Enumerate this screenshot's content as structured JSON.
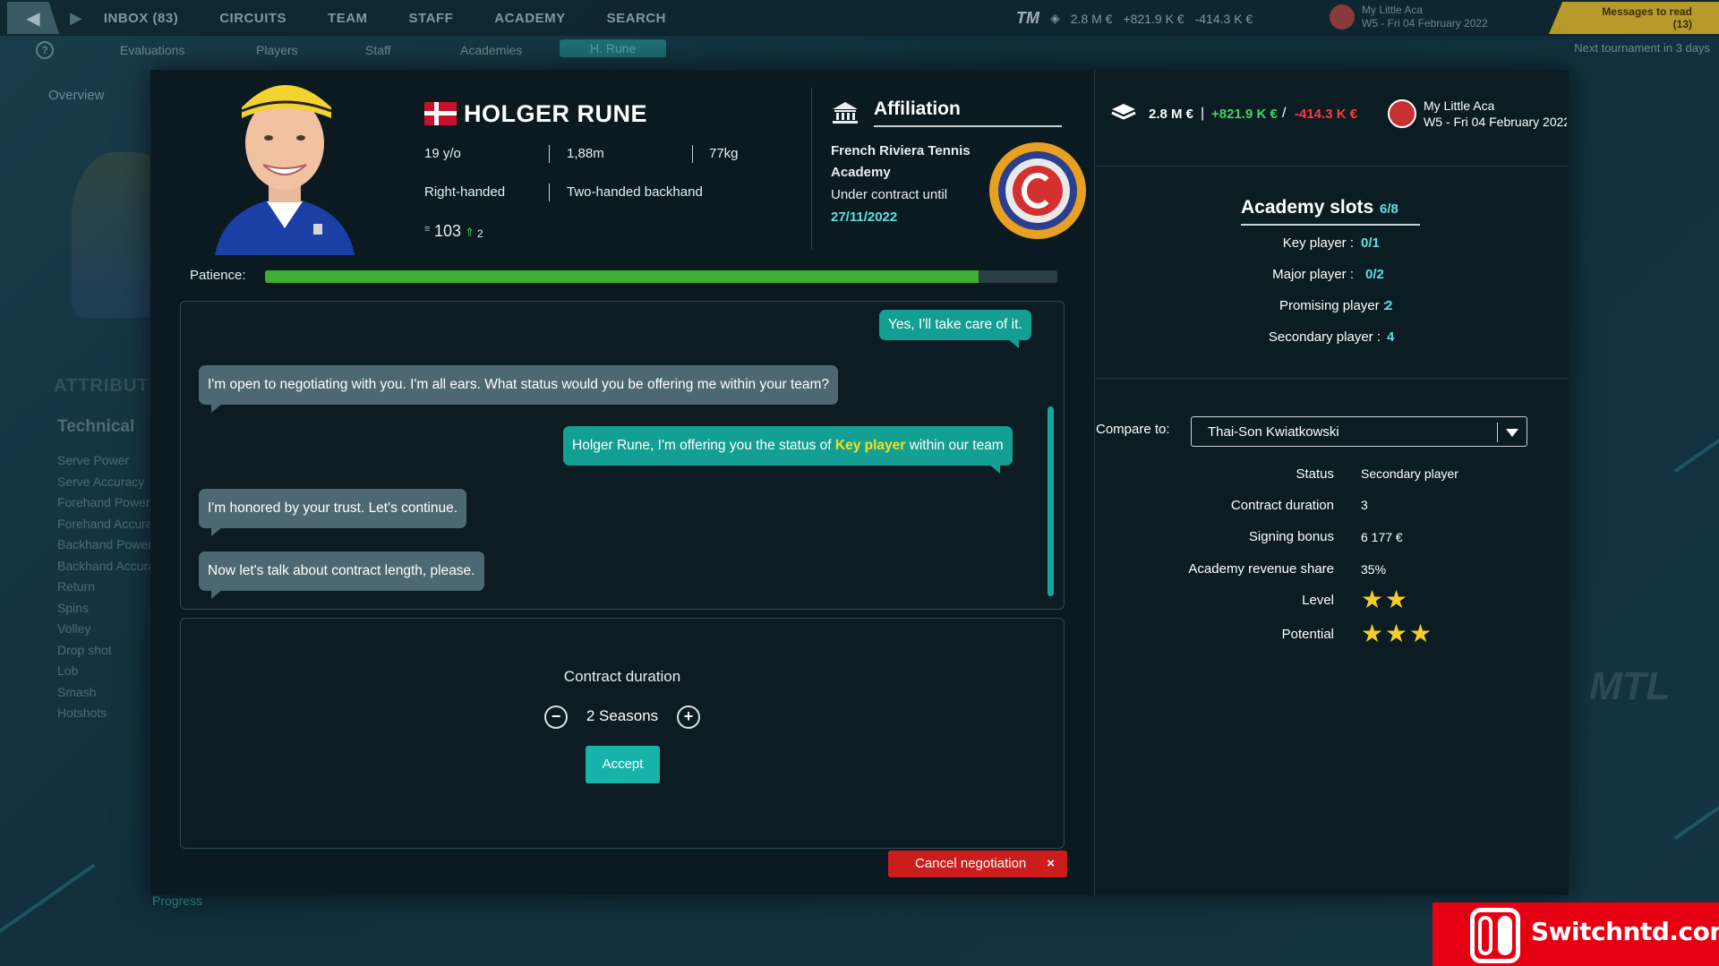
{
  "topnav": {
    "items": [
      "INBOX (83)",
      "CIRCUITS",
      "TEAM",
      "STAFF",
      "ACADEMY",
      "SEARCH"
    ],
    "money": "2.8 M €",
    "money_plus": "+821.9 K €",
    "money_minus": "-414.3 K €",
    "academy_name": "My Little Aca",
    "date": "W5 - Fri 04 February 2022",
    "messages": "Messages to read (13)",
    "next_tournament": "Next tournament in 3 days"
  },
  "subnav": {
    "items": [
      "Evaluations",
      "Players",
      "Staff",
      "Academies",
      "H. Rune"
    ]
  },
  "background": {
    "overview": "Overview",
    "attributes": "ATTRIBUTES",
    "technical": "Technical",
    "skills": [
      "Serve Power",
      "Serve Accuracy",
      "Forehand Power",
      "Forehand Accuracy",
      "Backhand Power",
      "Backhand Accuracy",
      "Return",
      "Spins",
      "Volley",
      "Drop shot",
      "Lob",
      "Smash",
      "Hotshots"
    ],
    "progress": "Progress"
  },
  "player": {
    "name": "HOLGER RUNE",
    "age": "19 y/o",
    "height": "1,88m",
    "weight": "77kg",
    "hand": "Right-handed",
    "backhand": "Two-handed backhand",
    "rank": "103",
    "rank_change": "2"
  },
  "affiliation": {
    "title": "Affiliation",
    "club_line1": "French Riviera Tennis",
    "club_line2": "Academy",
    "contract_label": "Under contract until",
    "contract_date": "27/11/2022"
  },
  "patience": {
    "label": "Patience:",
    "level": 0.9
  },
  "chat": {
    "m1": "Yes, I'll take care of it.",
    "m2": "I'm open to negotiating with you. I'm all ears. What status would you be offering me within your team?",
    "m3_prefix": "Holger Rune, I'm offering you the status of ",
    "m3_highlight": "Key player",
    "m3_suffix": " within our team",
    "m4": "I'm honored by your trust. Let's continue.",
    "m5": "Now let's talk about contract length, please."
  },
  "contract": {
    "title": "Contract duration",
    "minus": "−",
    "plus": "+",
    "value": "2 Seasons",
    "accept": "Accept"
  },
  "cancel": {
    "label": "Cancel negotiation",
    "x": "×"
  },
  "right": {
    "money": "2.8 M €",
    "money_plus": "+821.9 K €",
    "money_minus": "-414.3 K €",
    "academy_name": "My Little Aca",
    "date": "W5 - Fri 04 February 2022",
    "slots_title": "Academy slots",
    "slots_count": "6/8",
    "slots": [
      {
        "label": "Key player :",
        "value": "0/1"
      },
      {
        "label": "Major player :",
        "value": "0/2"
      },
      {
        "label": "Promising player :",
        "value": "2"
      },
      {
        "label": "Secondary player :",
        "value": "4"
      }
    ],
    "compare_label": "Compare to:",
    "compare_value": "Thai-Son Kwiatkowski",
    "status_label": "Status",
    "status_value": "Secondary player",
    "duration_label": "Contract duration",
    "duration_value": "3",
    "bonus_label": "Signing bonus",
    "bonus_value": "6 177 €",
    "revenue_label": "Academy revenue share",
    "revenue_value": "35%",
    "level_label": "Level",
    "level_stars": 2,
    "potential_label": "Potential",
    "potential_stars": 3
  },
  "watermark": {
    "text": "Switchntd.com"
  },
  "colors": {
    "accent_teal": "#139f94",
    "highlight_yellow": "#f4e21c",
    "positive_green": "#47d061",
    "negative_red": "#ff3b3b",
    "cancel_red": "#cc1d1d",
    "star_gold": "#f3cd2a"
  }
}
